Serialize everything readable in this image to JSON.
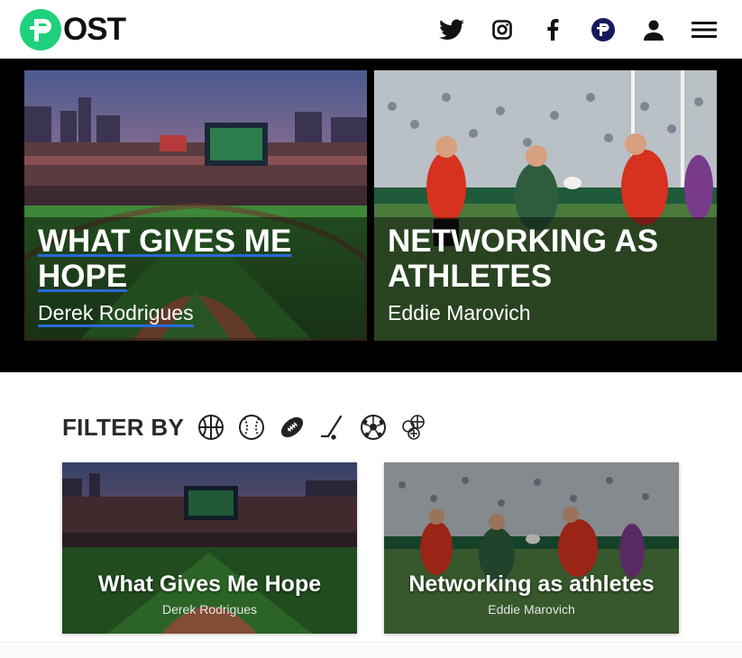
{
  "header": {
    "logo_text": "OST",
    "logo_color": "#1fd07c",
    "nav": [
      {
        "name": "twitter-icon"
      },
      {
        "name": "instagram-icon"
      },
      {
        "name": "facebook-icon"
      },
      {
        "name": "post-coin-icon"
      },
      {
        "name": "user-account-icon"
      },
      {
        "name": "hamburger-menu-icon"
      }
    ]
  },
  "hero": {
    "stories": [
      {
        "title": "WHAT GIVES ME HOPE",
        "author": "Derek Rodrigues",
        "image": "baseball-stadium-photo"
      },
      {
        "title": "NETWORKING AS ATHLETES",
        "author": "Eddie Marovich",
        "image": "rugby-match-photo"
      }
    ],
    "link_underline_color": "#2a6ad8"
  },
  "filter": {
    "label": "FILTER BY",
    "icons": [
      "basketball-icon",
      "baseball-icon",
      "football-icon",
      "hockey-stick-icon",
      "soccer-ball-icon",
      "multi-sport-icon"
    ]
  },
  "cards": [
    {
      "title": "What Gives Me Hope",
      "author": "Derek Rodrigues",
      "image": "baseball-stadium-photo"
    },
    {
      "title": "Networking as athletes",
      "author": "Eddie Marovich",
      "image": "rugby-match-photo"
    }
  ]
}
